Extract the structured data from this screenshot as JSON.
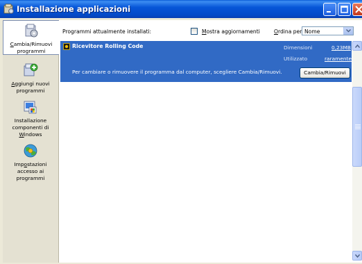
{
  "window": {
    "title": "Installazione applicazioni"
  },
  "tasks": [
    {
      "label_html_parts": [
        "C",
        "ambia/Rimuovi",
        "programmi"
      ],
      "icon": "change-remove-programs-icon",
      "selected": true
    },
    {
      "label_html_parts": [
        "A",
        "ggiungi nuovi",
        "programmi"
      ],
      "icon": "add-programs-icon",
      "selected": false
    },
    {
      "label_parts": [
        "Installazione",
        "componenti di",
        "W",
        "indows"
      ],
      "icon": "windows-components-icon",
      "selected": false
    },
    {
      "label_parts": [
        "Imp",
        "o",
        "stazioni",
        "accesso ai",
        "programmi"
      ],
      "icon": "program-access-icon",
      "selected": false
    }
  ],
  "header": {
    "installed_label": "Programmi attualmente installati:",
    "show_updates_label_ul": "M",
    "show_updates_label_rest": "ostra aggiornamenti",
    "show_updates_checked": false,
    "sort_label_ul": "O",
    "sort_label_rest": "rdina per:",
    "sort_value": "Nome"
  },
  "program": {
    "name": "Ricevitore Rolling Code",
    "size_label": "Dimensioni",
    "size_value": "0,23MB",
    "used_label": "Utilizzato",
    "used_value": "raramente",
    "description": "Per cambiare o rimuovere il programma dal computer, scegliere Cambia/Rimuovi.",
    "button_label": "Cambia/Rimuovi"
  },
  "colors": {
    "titlebar": "#0349c7",
    "selection": "#316ac5",
    "tasks_pane": "#e4e1d2"
  }
}
